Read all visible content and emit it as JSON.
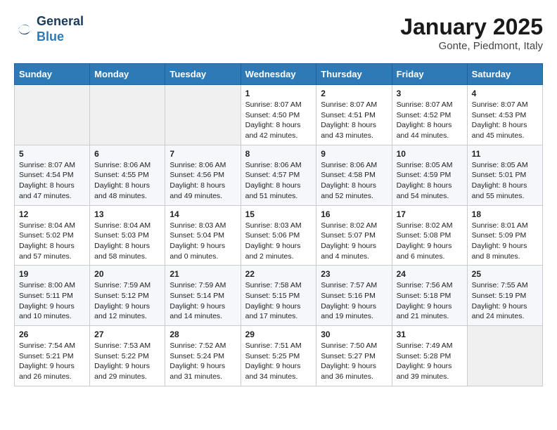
{
  "header": {
    "logo_line1": "General",
    "logo_line2": "Blue",
    "month_title": "January 2025",
    "location": "Gonte, Piedmont, Italy"
  },
  "weekdays": [
    "Sunday",
    "Monday",
    "Tuesday",
    "Wednesday",
    "Thursday",
    "Friday",
    "Saturday"
  ],
  "weeks": [
    [
      {
        "day": "",
        "info": ""
      },
      {
        "day": "",
        "info": ""
      },
      {
        "day": "",
        "info": ""
      },
      {
        "day": "1",
        "info": "Sunrise: 8:07 AM\nSunset: 4:50 PM\nDaylight: 8 hours and 42 minutes."
      },
      {
        "day": "2",
        "info": "Sunrise: 8:07 AM\nSunset: 4:51 PM\nDaylight: 8 hours and 43 minutes."
      },
      {
        "day": "3",
        "info": "Sunrise: 8:07 AM\nSunset: 4:52 PM\nDaylight: 8 hours and 44 minutes."
      },
      {
        "day": "4",
        "info": "Sunrise: 8:07 AM\nSunset: 4:53 PM\nDaylight: 8 hours and 45 minutes."
      }
    ],
    [
      {
        "day": "5",
        "info": "Sunrise: 8:07 AM\nSunset: 4:54 PM\nDaylight: 8 hours and 47 minutes."
      },
      {
        "day": "6",
        "info": "Sunrise: 8:06 AM\nSunset: 4:55 PM\nDaylight: 8 hours and 48 minutes."
      },
      {
        "day": "7",
        "info": "Sunrise: 8:06 AM\nSunset: 4:56 PM\nDaylight: 8 hours and 49 minutes."
      },
      {
        "day": "8",
        "info": "Sunrise: 8:06 AM\nSunset: 4:57 PM\nDaylight: 8 hours and 51 minutes."
      },
      {
        "day": "9",
        "info": "Sunrise: 8:06 AM\nSunset: 4:58 PM\nDaylight: 8 hours and 52 minutes."
      },
      {
        "day": "10",
        "info": "Sunrise: 8:05 AM\nSunset: 4:59 PM\nDaylight: 8 hours and 54 minutes."
      },
      {
        "day": "11",
        "info": "Sunrise: 8:05 AM\nSunset: 5:01 PM\nDaylight: 8 hours and 55 minutes."
      }
    ],
    [
      {
        "day": "12",
        "info": "Sunrise: 8:04 AM\nSunset: 5:02 PM\nDaylight: 8 hours and 57 minutes."
      },
      {
        "day": "13",
        "info": "Sunrise: 8:04 AM\nSunset: 5:03 PM\nDaylight: 8 hours and 58 minutes."
      },
      {
        "day": "14",
        "info": "Sunrise: 8:03 AM\nSunset: 5:04 PM\nDaylight: 9 hours and 0 minutes."
      },
      {
        "day": "15",
        "info": "Sunrise: 8:03 AM\nSunset: 5:06 PM\nDaylight: 9 hours and 2 minutes."
      },
      {
        "day": "16",
        "info": "Sunrise: 8:02 AM\nSunset: 5:07 PM\nDaylight: 9 hours and 4 minutes."
      },
      {
        "day": "17",
        "info": "Sunrise: 8:02 AM\nSunset: 5:08 PM\nDaylight: 9 hours and 6 minutes."
      },
      {
        "day": "18",
        "info": "Sunrise: 8:01 AM\nSunset: 5:09 PM\nDaylight: 9 hours and 8 minutes."
      }
    ],
    [
      {
        "day": "19",
        "info": "Sunrise: 8:00 AM\nSunset: 5:11 PM\nDaylight: 9 hours and 10 minutes."
      },
      {
        "day": "20",
        "info": "Sunrise: 7:59 AM\nSunset: 5:12 PM\nDaylight: 9 hours and 12 minutes."
      },
      {
        "day": "21",
        "info": "Sunrise: 7:59 AM\nSunset: 5:14 PM\nDaylight: 9 hours and 14 minutes."
      },
      {
        "day": "22",
        "info": "Sunrise: 7:58 AM\nSunset: 5:15 PM\nDaylight: 9 hours and 17 minutes."
      },
      {
        "day": "23",
        "info": "Sunrise: 7:57 AM\nSunset: 5:16 PM\nDaylight: 9 hours and 19 minutes."
      },
      {
        "day": "24",
        "info": "Sunrise: 7:56 AM\nSunset: 5:18 PM\nDaylight: 9 hours and 21 minutes."
      },
      {
        "day": "25",
        "info": "Sunrise: 7:55 AM\nSunset: 5:19 PM\nDaylight: 9 hours and 24 minutes."
      }
    ],
    [
      {
        "day": "26",
        "info": "Sunrise: 7:54 AM\nSunset: 5:21 PM\nDaylight: 9 hours and 26 minutes."
      },
      {
        "day": "27",
        "info": "Sunrise: 7:53 AM\nSunset: 5:22 PM\nDaylight: 9 hours and 29 minutes."
      },
      {
        "day": "28",
        "info": "Sunrise: 7:52 AM\nSunset: 5:24 PM\nDaylight: 9 hours and 31 minutes."
      },
      {
        "day": "29",
        "info": "Sunrise: 7:51 AM\nSunset: 5:25 PM\nDaylight: 9 hours and 34 minutes."
      },
      {
        "day": "30",
        "info": "Sunrise: 7:50 AM\nSunset: 5:27 PM\nDaylight: 9 hours and 36 minutes."
      },
      {
        "day": "31",
        "info": "Sunrise: 7:49 AM\nSunset: 5:28 PM\nDaylight: 9 hours and 39 minutes."
      },
      {
        "day": "",
        "info": ""
      }
    ]
  ]
}
